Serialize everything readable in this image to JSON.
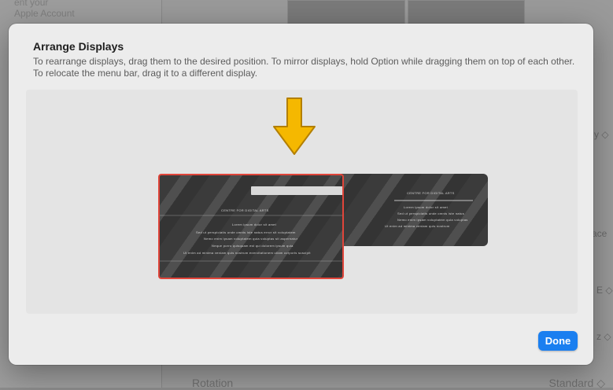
{
  "background": {
    "sidebar_text": "Apple Account",
    "sidebar_text_top": "ent your",
    "right_items": [
      "y ◇",
      "ace",
      "E ◇",
      "z ◇"
    ],
    "rotation_label": "Rotation",
    "rotation_value": "Standard ◇"
  },
  "sheet": {
    "title": "Arrange Displays",
    "description": "To rearrange displays, drag them to the desired position. To mirror displays, hold Option while dragging them on top of each other. To relocate the menu bar, drag it to a different display.",
    "done_label": "Done"
  },
  "displays": {
    "main": {
      "overlay_title": "CENTRE FOR DIGITAL ARTS",
      "overlay_lines": [
        "Lorem ipsum dolor sit amet",
        "Sed ut perspiciatis unde omnis iste natus error sit voluptatem",
        "Nemo enim ipsam voluptatem quia voluptas sit aspernatur",
        "Neque porro quisquam est qui dolorem ipsum quia",
        "Ut enim ad minima veniam quis nostrum exercitationem ullam corporis suscipit"
      ]
    },
    "secondary": {
      "overlay_title": "CENTRE FOR DIGITAL ARTS",
      "overlay_lines": [
        "Lorem ipsum dolor sit amet",
        "Sed ut perspiciatis unde omnis iste natus",
        "Nemo enim ipsam voluptatem quia voluptas",
        "Ut enim ad minima veniam quis nostrum"
      ]
    }
  },
  "colors": {
    "selection_border": "#e0453a",
    "accent": "#1a7ff0",
    "arrow": "#f5b800"
  }
}
